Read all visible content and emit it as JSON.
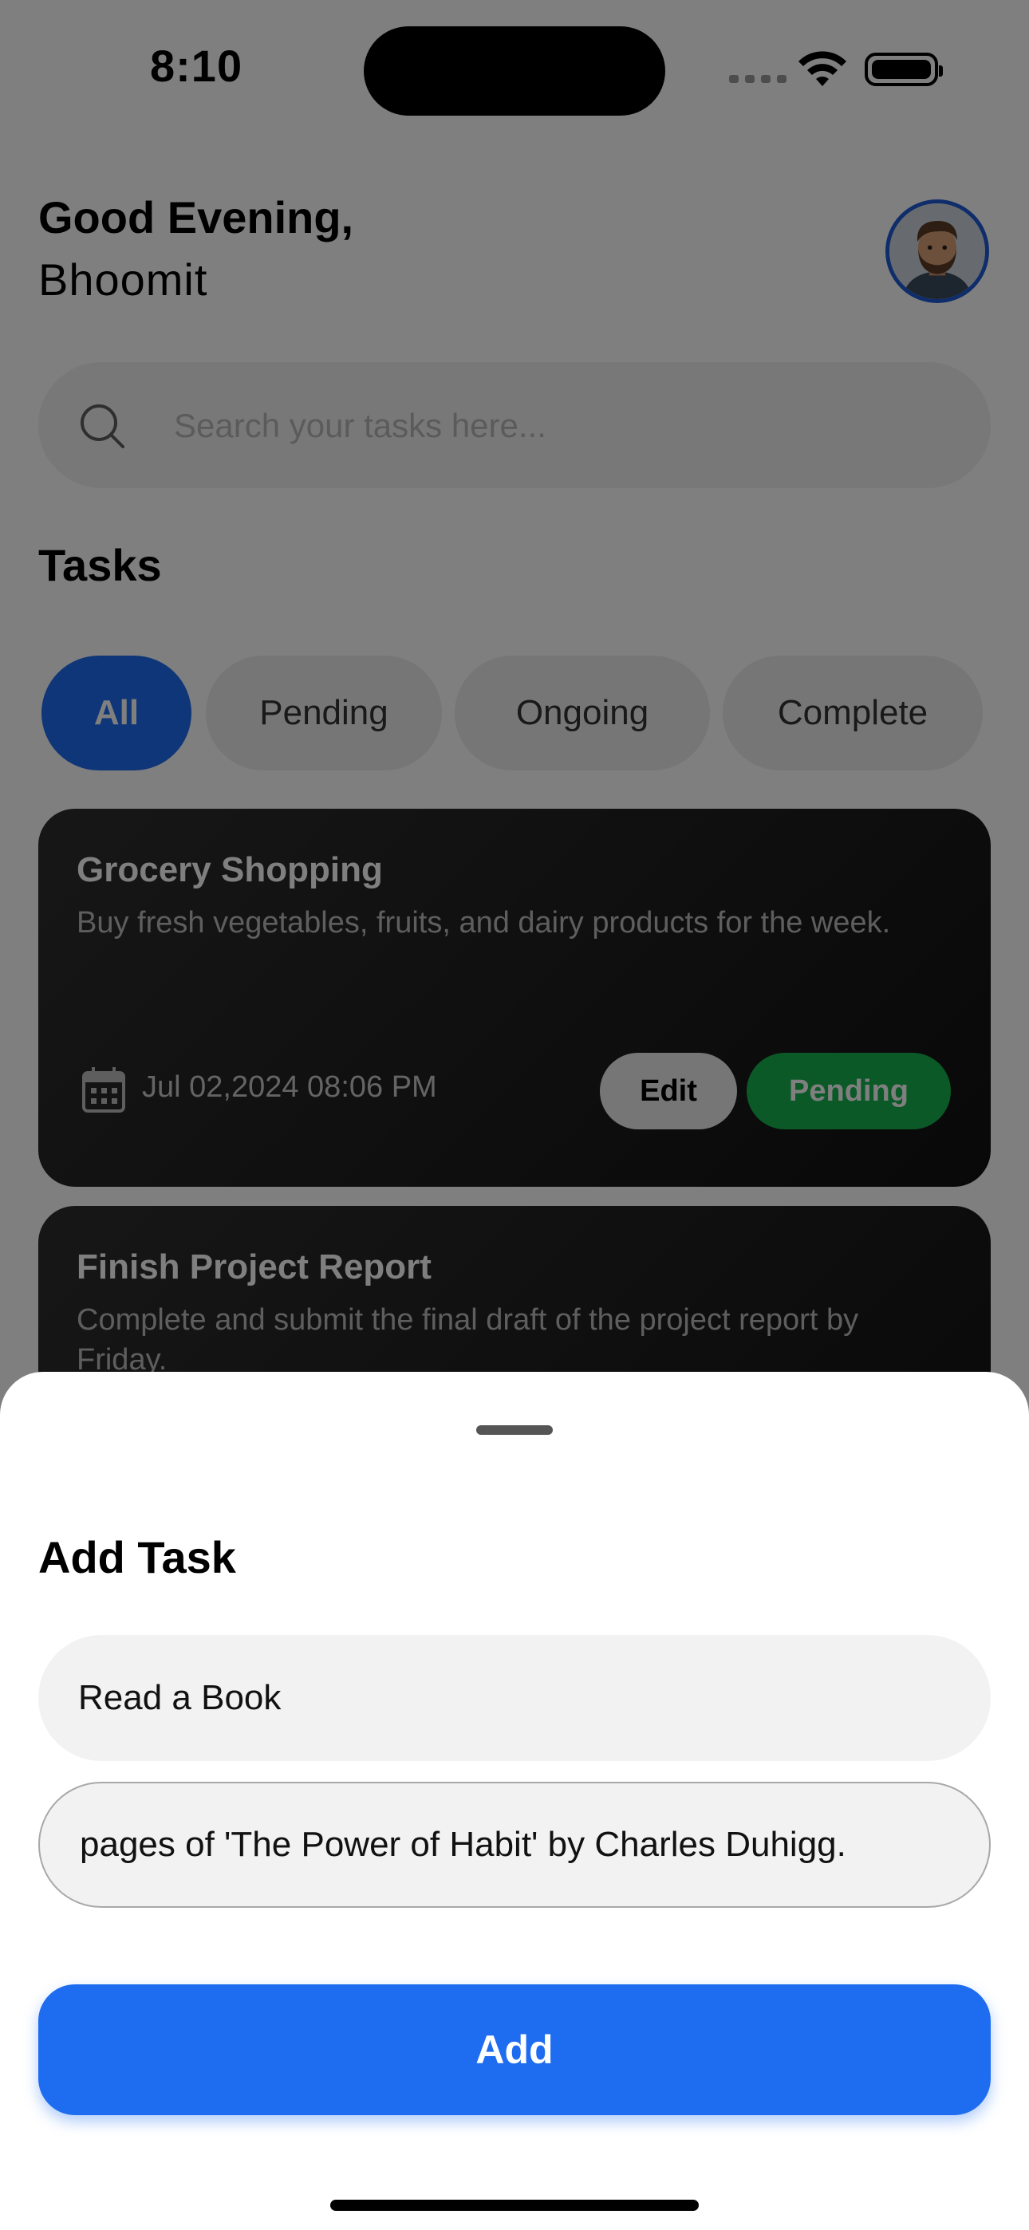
{
  "status_bar": {
    "time": "8:10"
  },
  "header": {
    "greeting": "Good Evening,",
    "username": "Bhoomit"
  },
  "search": {
    "placeholder": "Search your tasks here..."
  },
  "tasks_section": {
    "title": "Tasks"
  },
  "filters": [
    {
      "label": "All",
      "active": true
    },
    {
      "label": "Pending",
      "active": false
    },
    {
      "label": "Ongoing",
      "active": false
    },
    {
      "label": "Complete",
      "active": false
    }
  ],
  "task_cards": [
    {
      "title": "Grocery Shopping",
      "description": "Buy fresh vegetables, fruits, and dairy products for the week.",
      "date": "Jul 02,2024 08:06 PM",
      "edit_label": "Edit",
      "status": "Pending"
    },
    {
      "title": "Finish Project Report",
      "description": "Complete and submit the final draft of the project report by Friday."
    }
  ],
  "add_task_sheet": {
    "title": "Add Task",
    "task_title_value": "Read a Book",
    "task_description_value": "pages of 'The Power of Habit' by Charles Duhigg.",
    "add_label": "Add"
  },
  "colors": {
    "accent": "#1e6df0",
    "pending": "#14b34f"
  }
}
